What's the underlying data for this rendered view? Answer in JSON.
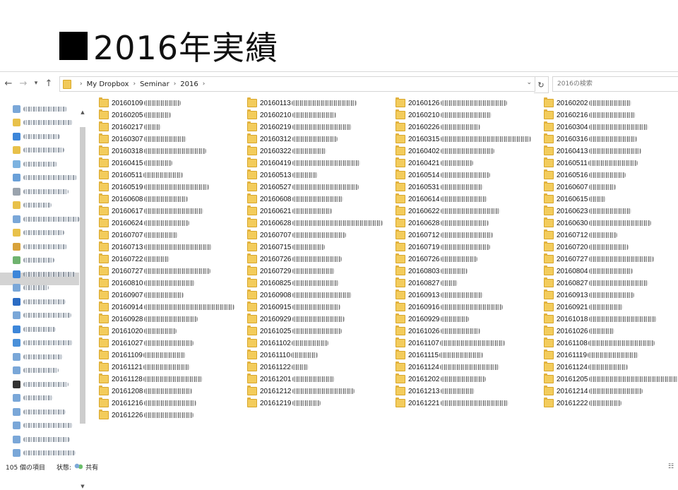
{
  "slide": {
    "title": "2016年実績"
  },
  "explorer": {
    "address": {
      "crumbs": [
        "My Dropbox",
        "Seminar",
        "2016"
      ]
    },
    "search": {
      "placeholder": "2016の検索"
    },
    "status": {
      "count": "105 個の項目",
      "state_label": "状態:",
      "state_value": "共有"
    },
    "columns": [
      [
        "20160109",
        "20160205",
        "20160217",
        "20160307",
        "20160318",
        "20160415",
        "20160511",
        "20160519",
        "20160608",
        "20160617",
        "20160624",
        "20160707",
        "20160713",
        "20160722",
        "20160727",
        "20160810",
        "20160907",
        "20160914",
        "20160928",
        "20161020",
        "20161027",
        "20161109",
        "20161121",
        "20161128",
        "20161208",
        "20161216",
        "20161226"
      ],
      [
        "20160113",
        "20160210",
        "20160219",
        "20160312",
        "20160322",
        "20160419",
        "20160513",
        "20160527",
        "20160608",
        "20160621",
        "20160628",
        "20160707",
        "20160715",
        "20160726",
        "20160729",
        "20160825",
        "20160908",
        "20160915",
        "20160929",
        "20161025",
        "20161102",
        "20161110",
        "20161122",
        "20161201",
        "20161212",
        "20161219"
      ],
      [
        "20160126",
        "20160210",
        "20160226",
        "20160315",
        "20160402",
        "20160421",
        "20160514",
        "20160531",
        "20160614",
        "20160622",
        "20160628",
        "20160712",
        "20160719",
        "20160726",
        "20160803",
        "20160827",
        "20160913",
        "20160916",
        "20160929",
        "20161026",
        "20161107",
        "20161115",
        "20161124",
        "20161202",
        "20161213",
        "20161221"
      ],
      [
        "20160202",
        "20160216",
        "20160304",
        "20160316",
        "20160413",
        "20160511",
        "20160516",
        "20160607",
        "20160615",
        "20160623",
        "20160630",
        "20160712",
        "20160720",
        "20160727",
        "20160804",
        "20160827",
        "20160913",
        "20160921",
        "20161018",
        "20161026",
        "20161108",
        "20161119",
        "20161124",
        "20161205",
        "20161214",
        "20161222"
      ]
    ]
  }
}
